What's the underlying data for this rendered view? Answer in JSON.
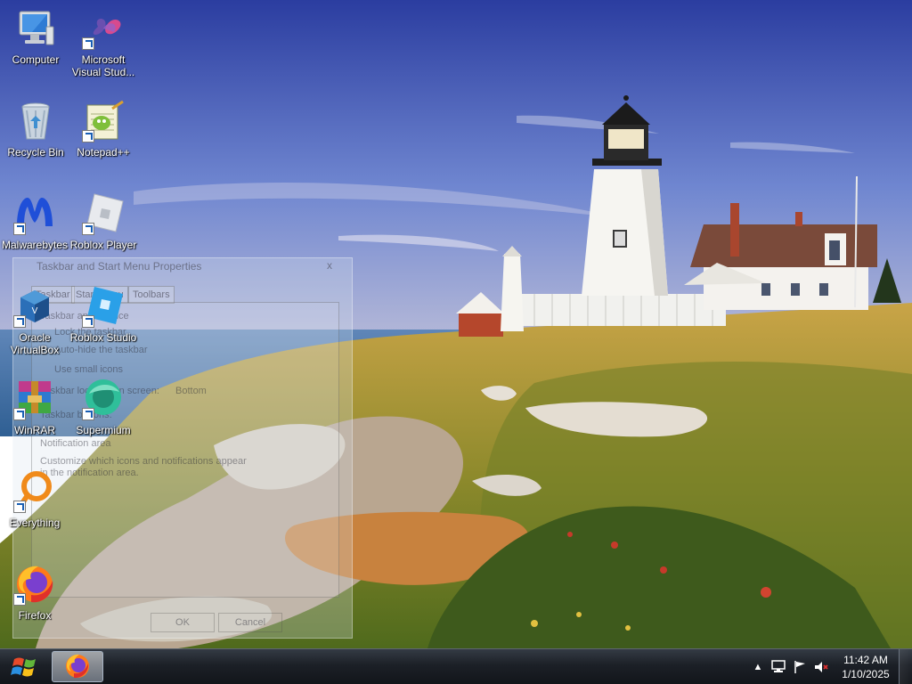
{
  "desktop": {
    "icons": [
      {
        "label": "Computer"
      },
      {
        "label": "Microsoft\nVisual Stud..."
      },
      {
        "label": "Recycle Bin"
      },
      {
        "label": "Notepad++"
      },
      {
        "label": "Malwarebytes"
      },
      {
        "label": "Roblox Player"
      },
      {
        "label": "Oracle\nVirtualBox"
      },
      {
        "label": "Roblox Studio"
      },
      {
        "label": "WinRAR"
      },
      {
        "label": "Supermium"
      },
      {
        "label": "Everything"
      },
      {
        "label": "Firefox"
      }
    ]
  },
  "dialog": {
    "title": "Taskbar and Start Menu Properties",
    "close": "x",
    "tabs": [
      "Taskbar",
      "Start Menu",
      "Toolbars"
    ],
    "lines": [
      "Taskbar appearance",
      "Lock the taskbar",
      "Auto-hide the taskbar",
      "Use small icons",
      "Taskbar location on screen:",
      "Bottom",
      "Taskbar buttons:",
      "Notification area",
      "Customize which icons and notifications appear",
      "in the notification area."
    ],
    "ok": "OK",
    "cancel": "Cancel"
  },
  "taskbar": {
    "pinned": [
      {
        "name": "Firefox"
      }
    ],
    "tray": {
      "icons": [
        "chevron-up-icon",
        "network-icon",
        "action-center-flag-icon",
        "volume-muted-icon"
      ]
    },
    "clock": {
      "time": "11:42 AM",
      "date": "1/10/2025"
    }
  },
  "colors": {
    "sky_top": "#2a3fa0",
    "sky_bottom": "#8fa3dc",
    "sea": "#3f6fa0",
    "grass": "#a9962f",
    "taskbar": "#1c2027"
  }
}
